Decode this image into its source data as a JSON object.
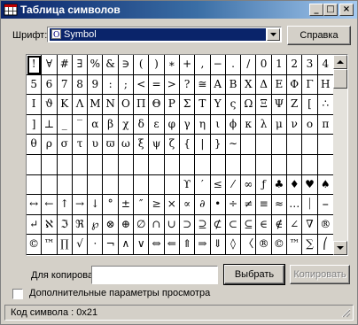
{
  "window": {
    "title": "Таблица символов",
    "min_glyph": "_",
    "max_glyph": "□",
    "close_glyph": "×"
  },
  "font_row": {
    "label": "Шрифт:",
    "selected_font": "Symbol",
    "help_button": "Справка"
  },
  "grid": {
    "columns": 20,
    "rows": [
      [
        "!",
        "∀",
        "#",
        "∃",
        "%",
        "&",
        "∋",
        "(",
        ")",
        "∗",
        "+",
        ",",
        "−",
        ".",
        "/",
        "0",
        "1",
        "2",
        "3",
        "4"
      ],
      [
        "5",
        "6",
        "7",
        "8",
        "9",
        ":",
        ";",
        "<",
        "=",
        ">",
        "?",
        "≅",
        "Α",
        "Β",
        "Χ",
        "Δ",
        "Ε",
        "Φ",
        "Γ",
        "Η"
      ],
      [
        "Ι",
        "ϑ",
        "Κ",
        "Λ",
        "Μ",
        "Ν",
        "Ο",
        "Π",
        "Θ",
        "Ρ",
        "Σ",
        "Τ",
        "Υ",
        "ς",
        "Ω",
        "Ξ",
        "Ψ",
        "Ζ",
        "[",
        "∴"
      ],
      [
        "]",
        "⊥",
        "_",
        "‾",
        "α",
        "β",
        "χ",
        "δ",
        "ε",
        "φ",
        "γ",
        "η",
        "ι",
        "ϕ",
        "κ",
        "λ",
        "μ",
        "ν",
        "ο",
        "π"
      ],
      [
        "θ",
        "ρ",
        "σ",
        "τ",
        "υ",
        "ϖ",
        "ω",
        "ξ",
        "ψ",
        "ζ",
        "{",
        "|",
        "}",
        "∼",
        "",
        "",
        "",
        "",
        "",
        ""
      ],
      [
        "",
        "",
        "",
        "",
        "",
        "",
        "",
        "",
        "",
        "",
        "",
        "",
        "",
        "",
        "",
        "",
        "",
        "",
        "",
        ""
      ],
      [
        "",
        "",
        "",
        "",
        "",
        "",
        "",
        "",
        "",
        "",
        "ϒ",
        "′",
        "≤",
        "⁄",
        "∞",
        "ƒ",
        "♣",
        "♦",
        "♥",
        "♠"
      ],
      [
        "↔",
        "←",
        "↑",
        "→",
        "↓",
        "°",
        "±",
        "″",
        "≥",
        "×",
        "∝",
        "∂",
        "•",
        "÷",
        "≠",
        "≡",
        "≈",
        "…",
        "⏐",
        "⎯"
      ],
      [
        "↵",
        "ℵ",
        "ℑ",
        "ℜ",
        "℘",
        "⊗",
        "⊕",
        "∅",
        "∩",
        "∪",
        "⊃",
        "⊇",
        "⊄",
        "⊂",
        "⊆",
        "∈",
        "∉",
        "∠",
        "∇",
        "®"
      ],
      [
        "©",
        "™",
        "∏",
        "√",
        "⋅",
        "¬",
        "∧",
        "∨",
        "⇔",
        "⇐",
        "⇑",
        "⇒",
        "⇓",
        "◊",
        "〈",
        "®",
        "©",
        "™",
        "∑",
        "⎛"
      ]
    ],
    "selected_index": 0
  },
  "copy_row": {
    "label": "Для копирования:",
    "value": "",
    "select_button": "Выбрать",
    "copy_button": "Копировать"
  },
  "advanced": {
    "label": "Дополнительные параметры просмотра",
    "checked": false
  },
  "status": {
    "text": "Код символа : 0x21"
  }
}
